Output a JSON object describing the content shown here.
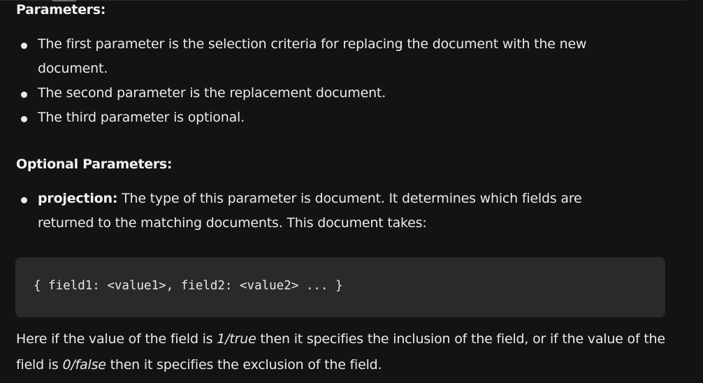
{
  "parameters": {
    "heading": "Parameters:",
    "items": [
      "The first parameter is the selection criteria for replacing the document with the new document.",
      "The second parameter is the replacement document.",
      "The third parameter is optional."
    ]
  },
  "optional": {
    "heading": "Optional Parameters:",
    "items": [
      {
        "term": "projection:",
        "text": " The type of this parameter is document. It determines which fields are returned to the matching documents. This document takes:"
      }
    ]
  },
  "code": {
    "line": "{ field1: <value1>, field2: <value2> ... }"
  },
  "explanation": {
    "part1": "Here if the value of the field is ",
    "em1": "1/true",
    "part2": " then it specifies the inclusion of the field, or if the value of the field is ",
    "em2": "0/false",
    "part3": " then it specifies the exclusion of the field."
  }
}
